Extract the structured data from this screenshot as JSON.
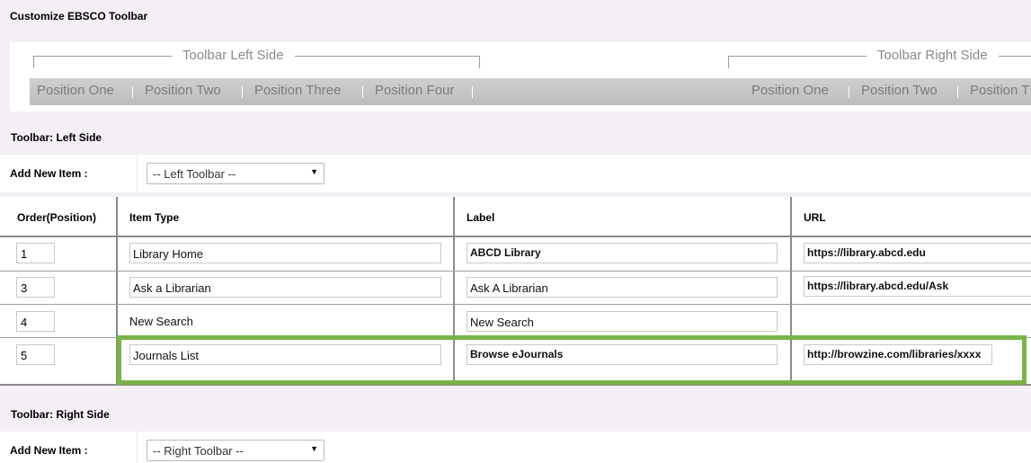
{
  "page_title": "Customize EBSCO Toolbar",
  "preview": {
    "left_title": "Toolbar Left Side",
    "right_title": "Toolbar Right Side",
    "left_positions": [
      "Position One",
      "Position Two",
      "Position Three",
      "Position Four"
    ],
    "right_positions": [
      "Position One",
      "Position Two",
      "Position T"
    ]
  },
  "left_section": {
    "heading": "Toolbar: Left Side",
    "add_label": "Add New Item :",
    "select_value": "-- Left Toolbar --"
  },
  "table": {
    "headers": [
      "Order(Position)",
      "Item Type",
      "Label",
      "URL"
    ],
    "rows": [
      {
        "order": "1",
        "item_type": "Library Home",
        "label": "ABCD Library",
        "url": "https://library.abcd.edu"
      },
      {
        "order": "3",
        "item_type": "Ask a Librarian",
        "label": "Ask A Librarian",
        "url": "https://library.abcd.edu/Ask"
      },
      {
        "order": "4",
        "item_type": "New Search",
        "label": "New Search",
        "url": ""
      },
      {
        "order": "5",
        "item_type": "Journals List",
        "label": "Browse eJournals",
        "url": "http://browzine.com/libraries/xxxx"
      }
    ]
  },
  "right_section": {
    "heading": "Toolbar: Right Side",
    "add_label": "Add New Item :",
    "select_value": "-- Right Toolbar --"
  },
  "colors": {
    "highlight": "#7ab346",
    "page_background": "#f4eff5"
  }
}
